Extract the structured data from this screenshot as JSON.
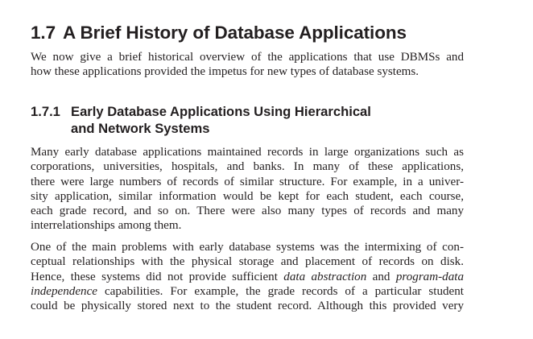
{
  "section": {
    "number": "1.7",
    "title": "A Brief History of Database Applications",
    "intro_lines": [
      "We now give a brief historical overview of the applications that use DBMSs and",
      "how these applications provided the impetus for new types of database systems."
    ]
  },
  "subsection": {
    "number": "1.7.1",
    "title_line1": "Early Database Applications Using Hierarchical",
    "title_line2": "and Network Systems"
  },
  "paragraph1": {
    "lines": [
      "Many early database applications maintained records in large organizations such as",
      "corporations, universities, hospitals, and banks. In many of these applications,",
      "there were large numbers of records of similar structure. For example, in a univer-",
      "sity application, similar information would be kept for each student, each course,",
      "each grade record, and so on. There were also many types of records and many",
      "interrelationships among them."
    ]
  },
  "paragraph2": {
    "line1": "One of the main problems with early database systems was the intermixing of con-",
    "line2": "ceptual relationships with the physical storage and placement of records on disk.",
    "line3_a": "Hence, these systems did not provide sufficient ",
    "line3_em1": "data abstraction",
    "line3_b": " and ",
    "line3_em2": "program-data",
    "line4_em": "independence",
    "line4_b": " capabilities. For example, the grade records of a particular student",
    "line5": "could be physically stored next to the student record. Although this provided very"
  }
}
